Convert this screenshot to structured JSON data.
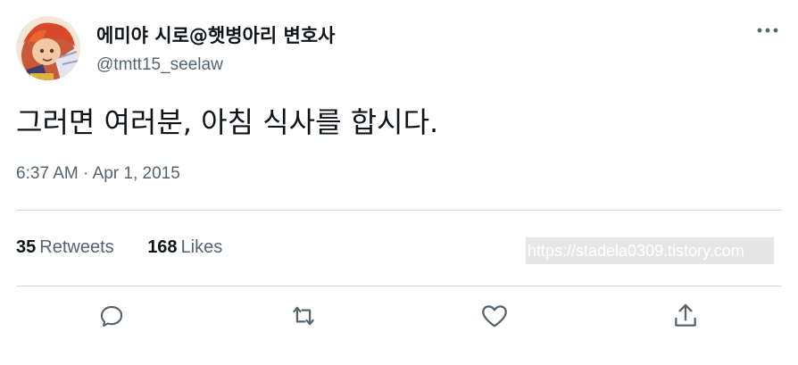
{
  "tweet": {
    "display_name": "에미야 시로@햇병아리 변호사",
    "handle": "@tmtt15_seelaw",
    "text": "그러면 여러분, 아침 식사를 합시다.",
    "time": "6:37 AM",
    "separator": "·",
    "date": "Apr 1, 2015"
  },
  "stats": {
    "retweets_count": "35",
    "retweets_label": "Retweets",
    "likes_count": "168",
    "likes_label": "Likes"
  },
  "watermark": {
    "text": "https://stadela0309.tistory.com"
  },
  "icons": {
    "more": "more-horizontal-icon",
    "reply": "reply-icon",
    "retweet": "retweet-icon",
    "like": "heart-icon",
    "share": "share-icon"
  },
  "colors": {
    "text_primary": "#0f1419",
    "text_secondary": "#536471",
    "divider": "#cfd9de"
  }
}
